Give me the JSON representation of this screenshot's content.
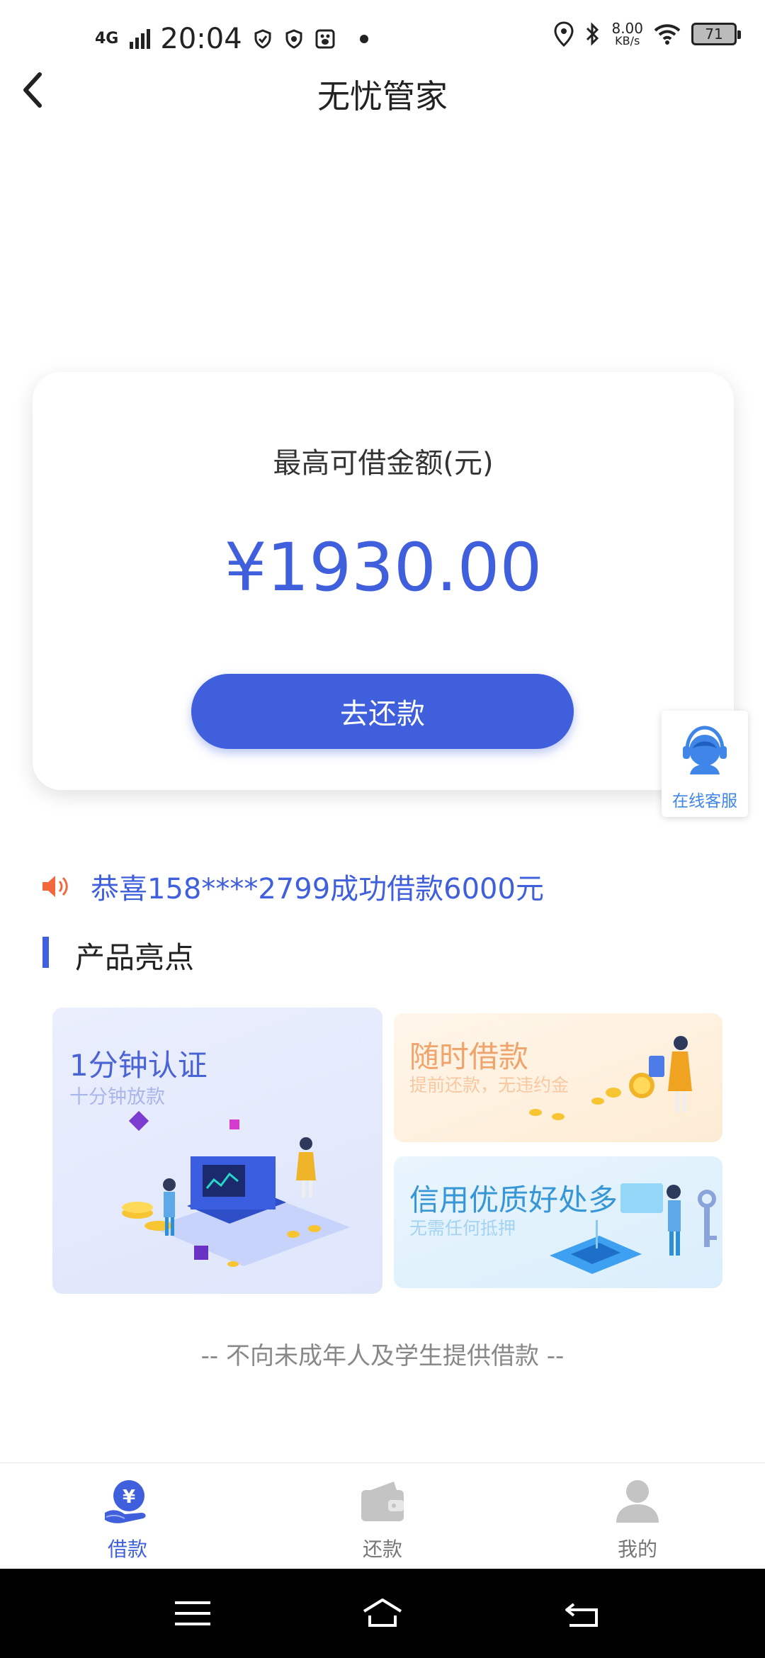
{
  "status_bar": {
    "network": "4G",
    "time": "20:04",
    "speed_value": "8.00",
    "speed_unit": "KB/s",
    "battery": "71"
  },
  "header": {
    "title": "无忧管家"
  },
  "card": {
    "label": "最高可借金额(元)",
    "amount": "¥1930.00",
    "button": "去还款"
  },
  "customer_service": {
    "label": "在线客服"
  },
  "notice": {
    "text": "恭喜158****2799成功借款6000元"
  },
  "section": {
    "title": "产品亮点"
  },
  "features": [
    {
      "title": "1分钟认证",
      "subtitle": "十分钟放款"
    },
    {
      "title": "随时借款",
      "subtitle": "提前还款，无违约金"
    },
    {
      "title": "信用优质好处多",
      "subtitle": "无需任何抵押"
    }
  ],
  "disclaimer": "-- 不向未成年人及学生提供借款 --",
  "bottom_nav": [
    {
      "label": "借款",
      "icon": "loan-yuan-icon",
      "active": true
    },
    {
      "label": "还款",
      "icon": "wallet-icon",
      "active": false
    },
    {
      "label": "我的",
      "icon": "user-icon",
      "active": false
    }
  ],
  "colors": {
    "accent": "#3f5fdc",
    "notice_icon": "#f0683c",
    "service_blue": "#3f86e8"
  }
}
